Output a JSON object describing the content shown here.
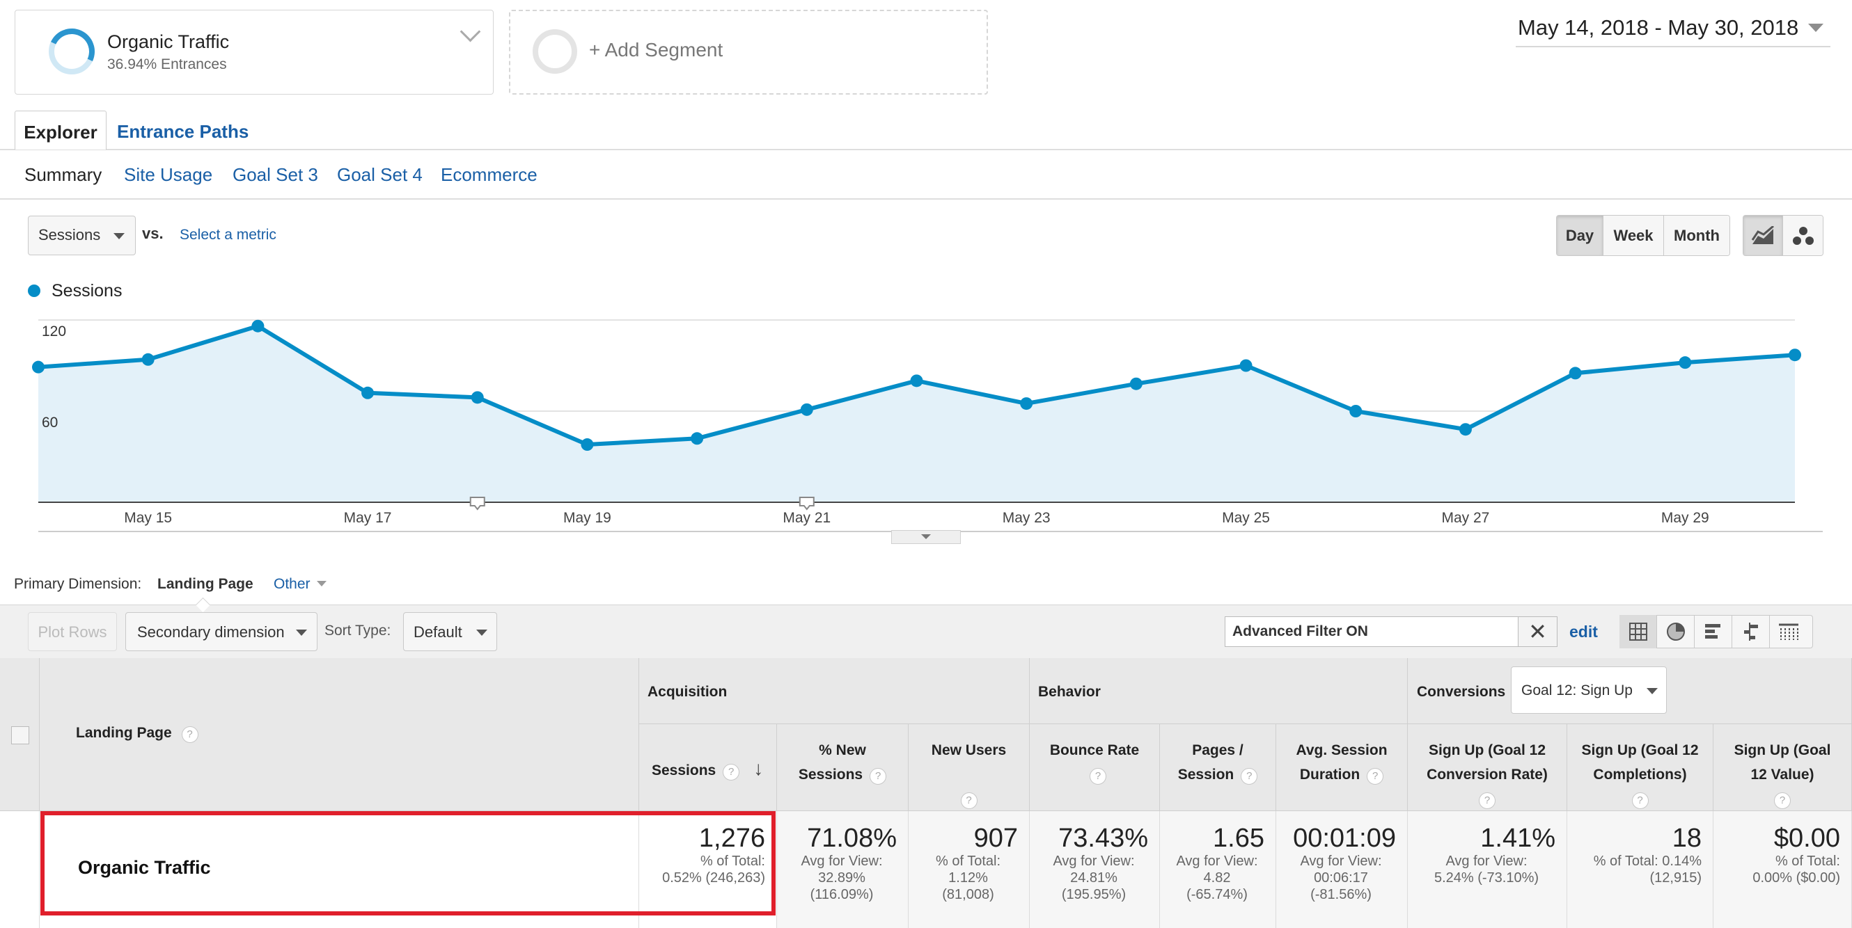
{
  "segments": {
    "active": {
      "name": "Organic Traffic",
      "detail": "36.94% Entrances"
    },
    "add_label": "+ Add Segment"
  },
  "date_range": "May 14, 2018 - May 30, 2018",
  "tabs": {
    "explorer": "Explorer",
    "entrance_paths": "Entrance Paths"
  },
  "subtabs": [
    "Summary",
    "Site Usage",
    "Goal Set 3",
    "Goal Set 4",
    "Ecommerce"
  ],
  "metric_controls": {
    "metric": "Sessions",
    "vs": "vs.",
    "select_metric": "Select a metric"
  },
  "period_buttons": {
    "day": "Day",
    "week": "Week",
    "month": "Month"
  },
  "chart_data": {
    "type": "area",
    "legend": "Sessions",
    "series_color": "#058dc7",
    "x": [
      "May 14",
      "May 15",
      "May 16",
      "May 17",
      "May 18",
      "May 19",
      "May 20",
      "May 21",
      "May 22",
      "May 23",
      "May 24",
      "May 25",
      "May 26",
      "May 27",
      "May 28",
      "May 29",
      "May 30"
    ],
    "values": [
      89,
      94,
      116,
      72,
      69,
      38,
      42,
      61,
      80,
      65,
      78,
      90,
      60,
      48,
      85,
      92,
      97
    ],
    "yticks": [
      "120",
      "60"
    ],
    "ylim": [
      0,
      120
    ],
    "xtick_labels": [
      "May 15",
      "May 17",
      "May 19",
      "May 21",
      "May 23",
      "May 25",
      "May 27",
      "May 29"
    ],
    "annotation_markers_on": [
      "May 18",
      "May 21"
    ],
    "grid": true
  },
  "dimension": {
    "label": "Primary Dimension:",
    "value": "Landing Page",
    "other": "Other"
  },
  "toolbar": {
    "plot_rows": "Plot Rows",
    "secondary": "Secondary dimension",
    "sort_label": "Sort Type:",
    "sort_value": "Default",
    "filter": "Advanced Filter ON",
    "edit": "edit"
  },
  "table": {
    "dimension_header": "Landing Page",
    "groups": {
      "acquisition": "Acquisition",
      "behavior": "Behavior",
      "conversions": "Conversions",
      "goal_select": "Goal 12: Sign Up"
    },
    "columns": [
      {
        "l1": "Sessions",
        "l2": ""
      },
      {
        "l1": "% New",
        "l2": "Sessions"
      },
      {
        "l1": "New Users",
        "l2": ""
      },
      {
        "l1": "Bounce Rate",
        "l2": ""
      },
      {
        "l1": "Pages /",
        "l2": "Session"
      },
      {
        "l1": "Avg. Session",
        "l2": "Duration"
      },
      {
        "l1": "Sign Up (Goal 12",
        "l2": "Conversion Rate)"
      },
      {
        "l1": "Sign Up (Goal 12",
        "l2": "Completions)"
      },
      {
        "l1": "Sign Up (Goal",
        "l2": "12 Value)"
      }
    ],
    "row_label": "Organic Traffic",
    "cells": [
      {
        "value": "1,276",
        "s1": "% of Total:",
        "s2": "0.52% (246,263)",
        "s3": ""
      },
      {
        "value": "71.08%",
        "s1": "Avg for View:",
        "s2": "32.89%",
        "s3": "(116.09%)"
      },
      {
        "value": "907",
        "s1": "% of Total:",
        "s2": "1.12%",
        "s3": "(81,008)"
      },
      {
        "value": "73.43%",
        "s1": "Avg for View:",
        "s2": "24.81%",
        "s3": "(195.95%)"
      },
      {
        "value": "1.65",
        "s1": "Avg for View:",
        "s2": "4.82",
        "s3": "(-65.74%)"
      },
      {
        "value": "00:01:09",
        "s1": "Avg for View:",
        "s2": "00:06:17",
        "s3": "(-81.56%)"
      },
      {
        "value": "1.41%",
        "s1": "Avg for View:",
        "s2": "5.24% (-73.10%)",
        "s3": ""
      },
      {
        "value": "18",
        "s1": "% of Total: 0.14%",
        "s2": "(12,915)",
        "s3": ""
      },
      {
        "value": "$0.00",
        "s1": "% of Total:",
        "s2": "0.00% ($0.00)",
        "s3": ""
      }
    ]
  }
}
